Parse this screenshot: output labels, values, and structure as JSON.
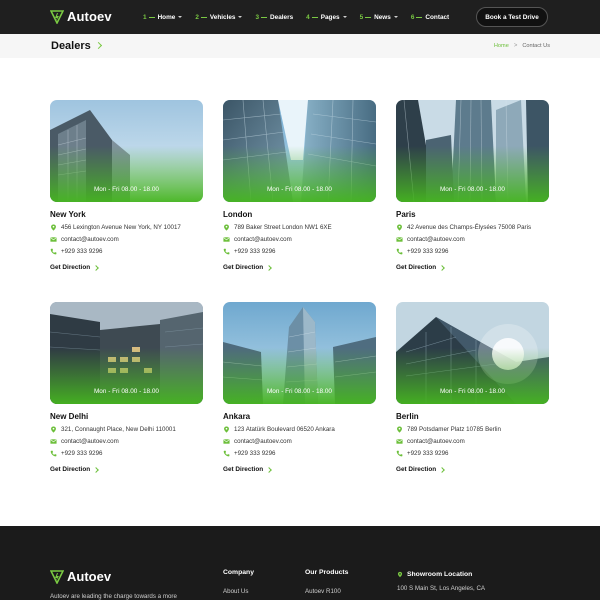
{
  "header": {
    "logo_text": "Autoev",
    "nav": [
      {
        "num": "1",
        "label": "Home",
        "dropdown": true
      },
      {
        "num": "2",
        "label": "Vehicles",
        "dropdown": true
      },
      {
        "num": "3",
        "label": "Dealers",
        "dropdown": false
      },
      {
        "num": "4",
        "label": "Pages",
        "dropdown": true
      },
      {
        "num": "5",
        "label": "News",
        "dropdown": true
      },
      {
        "num": "6",
        "label": "Contact",
        "dropdown": false
      }
    ],
    "cta_label": "Book a Test Drive"
  },
  "breadcrumb": {
    "title": "Dealers",
    "home": "Home",
    "separator": ">",
    "current": "Contact Us"
  },
  "dealers": [
    {
      "city": "New York",
      "hours": "Mon - Fri 08.00 - 18.00",
      "address": "456 Lexington Avenue New York, NY 10017",
      "email": "contact@autoev.com",
      "phone": "+929 333 9296",
      "link": "Get Direction"
    },
    {
      "city": "London",
      "hours": "Mon - Fri 08.00 - 18.00",
      "address": "789 Baker Street London NW1 6XE",
      "email": "contact@autoev.com",
      "phone": "+929 333 9296",
      "link": "Get Direction"
    },
    {
      "city": "Paris",
      "hours": "Mon - Fri 08.00 - 18.00",
      "address": "42 Avenue des Champs-Élysées 75008 Paris",
      "email": "contact@autoev.com",
      "phone": "+929 333 9296",
      "link": "Get Direction"
    },
    {
      "city": "New Delhi",
      "hours": "Mon - Fri 08.00 - 18.00",
      "address": "321, Connaught Place, New Delhi 110001",
      "email": "contact@autoev.com",
      "phone": "+929 333 9296",
      "link": "Get Direction"
    },
    {
      "city": "Ankara",
      "hours": "Mon - Fri 08.00 - 18.00",
      "address": "123 Atatürk Boulevard 06520 Ankara",
      "email": "contact@autoev.com",
      "phone": "+929 333 9296",
      "link": "Get Direction"
    },
    {
      "city": "Berlin",
      "hours": "Mon - Fri 08.00 - 18.00",
      "address": "789 Potsdamer Platz 10785 Berlin",
      "email": "contact@autoev.com",
      "phone": "+929 333 9296",
      "link": "Get Direction"
    }
  ],
  "footer": {
    "logo_text": "Autoev",
    "description": "Autoev are leading the charge towards a more",
    "company_title": "Company",
    "company_link": "About Us",
    "products_title": "Our Products",
    "products_link": "Autoev R100",
    "showroom_title": "Showroom Location",
    "showroom_address": "100 S Main St, Los Angeles, CA"
  },
  "colors": {
    "accent": "#7ac943",
    "dark": "#1f1f1f",
    "footer": "#1b1b1b"
  },
  "icons": {
    "address": "map-pin-icon",
    "email": "mail-icon",
    "phone": "phone-icon",
    "direction": "chevron-right-icon"
  }
}
